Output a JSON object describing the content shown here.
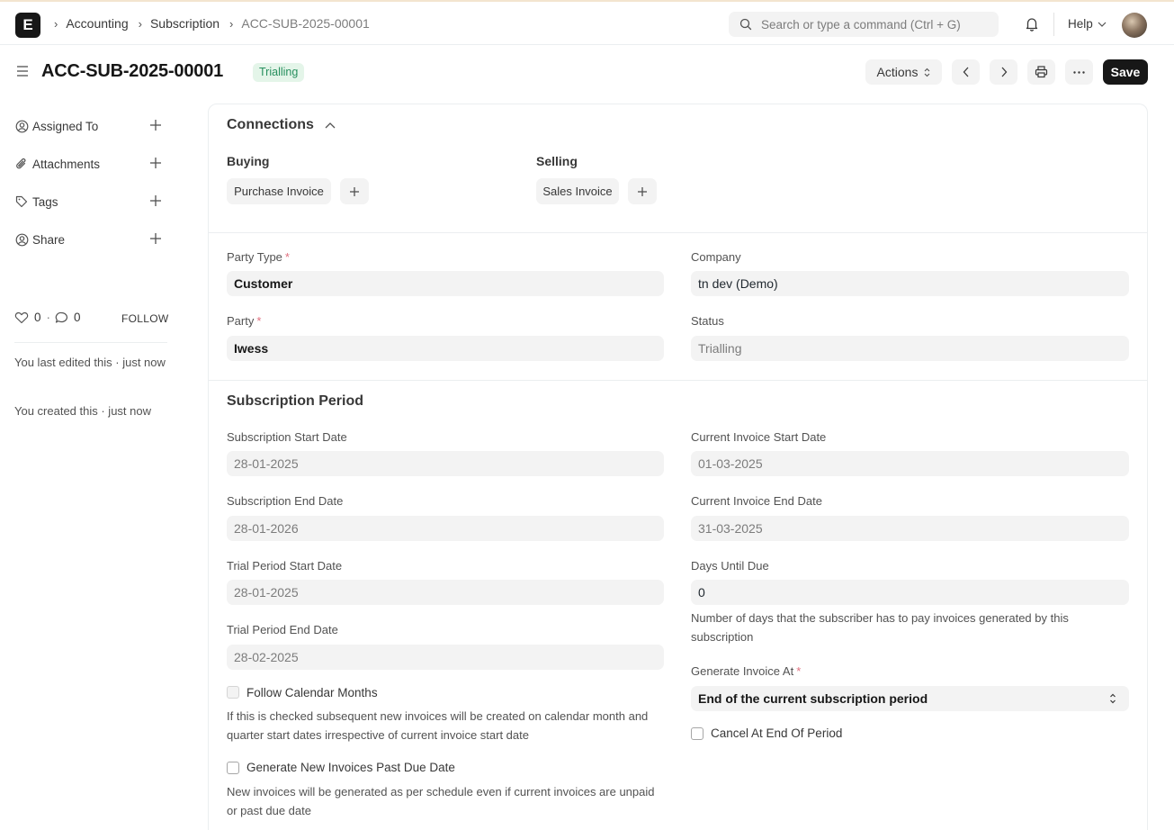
{
  "navbar": {
    "logo": "E",
    "breadcrumbs": [
      "Accounting",
      "Subscription",
      "ACC-SUB-2025-00001"
    ],
    "search_placeholder": "Search or type a command (Ctrl + G)",
    "help_label": "Help"
  },
  "page": {
    "title": "ACC-SUB-2025-00001",
    "status_badge": "Trialling",
    "actions_label": "Actions",
    "save_label": "Save"
  },
  "sidebar": {
    "items": [
      {
        "label": "Assigned To",
        "icon": "assign-user-icon"
      },
      {
        "label": "Attachments",
        "icon": "paperclip-icon"
      },
      {
        "label": "Tags",
        "icon": "tag-icon"
      },
      {
        "label": "Share",
        "icon": "share-user-icon"
      }
    ],
    "likes": "0",
    "comments": "0",
    "follow_label": "FOLLOW",
    "last_edited": "You last edited this · just now",
    "created": "You created this · just now"
  },
  "connections": {
    "title": "Connections",
    "groups": [
      {
        "label": "Buying",
        "link": "Purchase Invoice"
      },
      {
        "label": "Selling",
        "link": "Sales Invoice"
      }
    ]
  },
  "party": {
    "party_type_label": "Party Type",
    "party_type": "Customer",
    "party_label": "Party",
    "party": "Iwess",
    "company_label": "Company",
    "company": "tn dev (Demo)",
    "status_label": "Status",
    "status": "Trialling"
  },
  "subscription_period": {
    "title": "Subscription Period",
    "start_label": "Subscription Start Date",
    "start": "28-01-2025",
    "end_label": "Subscription End Date",
    "end": "28-01-2026",
    "trial_start_label": "Trial Period Start Date",
    "trial_start": "28-01-2025",
    "trial_end_label": "Trial Period End Date",
    "trial_end": "28-02-2025",
    "follow_calendar_label": "Follow Calendar Months",
    "follow_calendar_desc": "If this is checked subsequent new invoices will be created on calendar month and quarter start dates irrespective of current invoice start date",
    "generate_past_due_label": "Generate New Invoices Past Due Date",
    "generate_past_due_desc": "New invoices will be generated as per schedule even if current invoices are unpaid or past due date",
    "inv_start_label": "Current Invoice Start Date",
    "inv_start": "01-03-2025",
    "inv_end_label": "Current Invoice End Date",
    "inv_end": "31-03-2025",
    "days_due_label": "Days Until Due",
    "days_due": "0",
    "days_due_desc": "Number of days that the subscriber has to pay invoices generated by this subscription",
    "generate_at_label": "Generate Invoice At",
    "generate_at": "End of the current subscription period",
    "cancel_label": "Cancel At End Of Period"
  }
}
